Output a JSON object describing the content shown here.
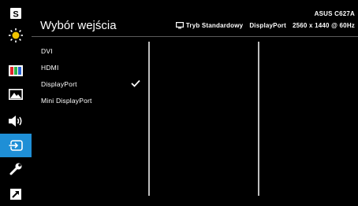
{
  "sidebar": {
    "items": [
      {
        "icon": "splendid-icon",
        "active": false
      },
      {
        "icon": "brightness-icon",
        "active": false
      },
      {
        "icon": "color-icon",
        "active": false
      },
      {
        "icon": "image-icon",
        "active": false
      },
      {
        "icon": "sound-icon",
        "active": false
      },
      {
        "icon": "input-select-icon",
        "active": true
      },
      {
        "icon": "system-setup-icon",
        "active": false
      },
      {
        "icon": "shortcut-icon",
        "active": false
      }
    ],
    "accent": "#1f8fd6"
  },
  "header": {
    "title": "Wybór wejścia",
    "model": "ASUS C627A",
    "mode": "Tryb Standardowy",
    "input": "DisplayPort",
    "resolution": "2560 x 1440 @ 60Hz"
  },
  "menu": {
    "options": [
      {
        "label": "DVI",
        "selected": false
      },
      {
        "label": "HDMI",
        "selected": false
      },
      {
        "label": "DisplayPort",
        "selected": true
      },
      {
        "label": "Mini DisplayPort",
        "selected": false
      }
    ]
  }
}
